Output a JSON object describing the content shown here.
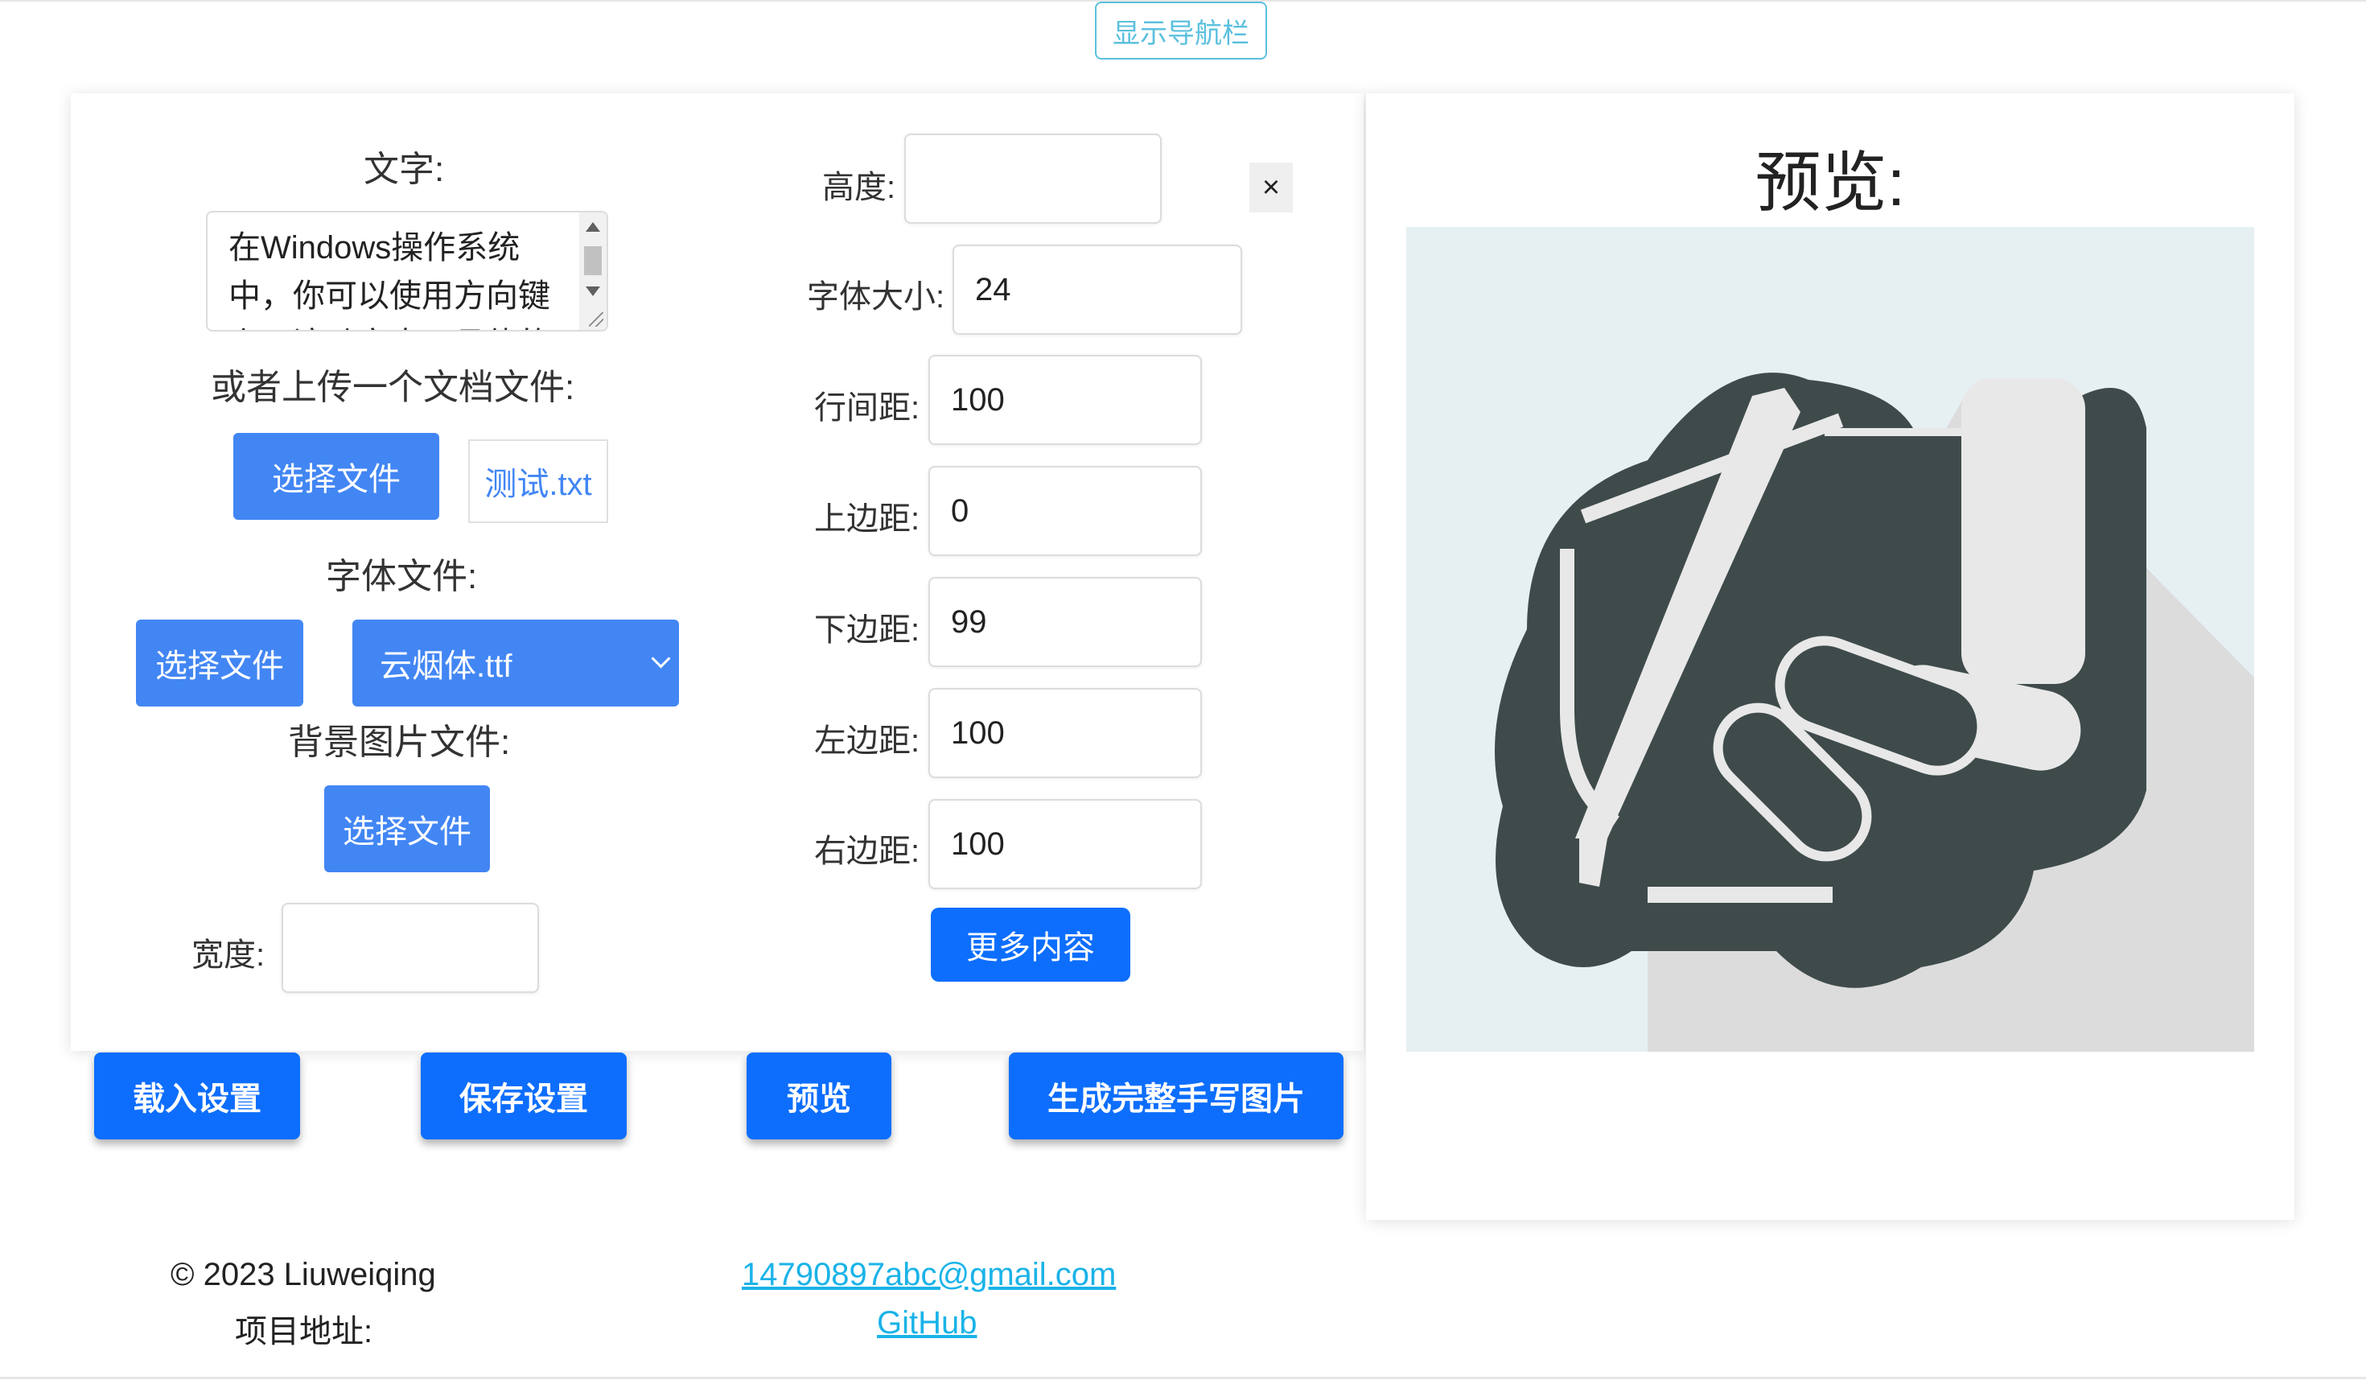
{
  "nav": {
    "toggle_label": "显示导航栏"
  },
  "form": {
    "text_label": "文字:",
    "text_value": "在Windows操作系统中，你可以使用方向键上下滚动文本，具体的操作方法",
    "upload_doc_label": "或者上传一个文档文件:",
    "choose_file_label": "选择文件",
    "doc_file_name": "测试.txt",
    "font_file_label": "字体文件:",
    "font_choose_label": "选择文件",
    "font_selected": "云烟体.ttf",
    "bg_image_label": "背景图片文件:",
    "bg_choose_label": "选择文件",
    "width_label": "宽度:",
    "width_value": "",
    "height_label": "高度:",
    "height_value": "",
    "close_label": "×",
    "font_size_label": "字体大小:",
    "font_size_value": "24",
    "line_spacing_label": "行间距:",
    "line_spacing_value": "100",
    "top_margin_label": "上边距:",
    "top_margin_value": "0",
    "bottom_margin_label": "下边距:",
    "bottom_margin_value": "99",
    "left_margin_label": "左边距:",
    "left_margin_value": "100",
    "right_margin_label": "右边距:",
    "right_margin_value": "100",
    "more_label": "更多内容"
  },
  "actions": {
    "load_settings": "载入设置",
    "save_settings": "保存设置",
    "preview": "预览",
    "generate": "生成完整手写图片"
  },
  "preview": {
    "title": "预览:",
    "image_icon": "handwriting-pen-hand-icon"
  },
  "footer": {
    "copyright": "© 2023 Liuweiqing",
    "email": "14790897abc@gmail.com",
    "project_label": "项目地址:",
    "project_link": "GitHub"
  },
  "colors": {
    "primary": "#4286f4",
    "primary_bold": "#0d6efd",
    "link": "#1ab3e8",
    "nav_outline": "#5bc0de",
    "icon_dark": "#3f4b4b"
  }
}
